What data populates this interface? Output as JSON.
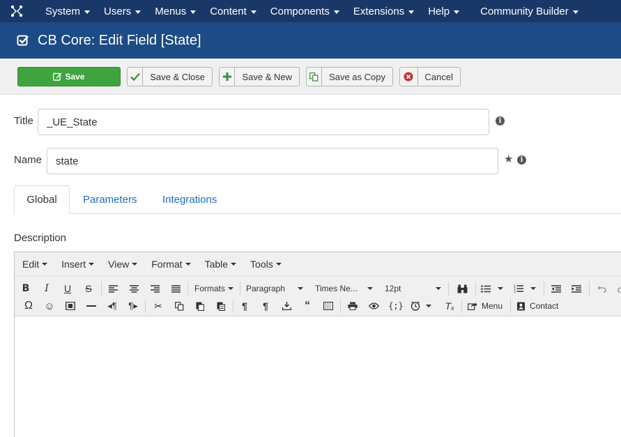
{
  "nav": {
    "items": [
      {
        "label": "System",
        "name": "nav-system"
      },
      {
        "label": "Users",
        "name": "nav-users"
      },
      {
        "label": "Menus",
        "name": "nav-menus"
      },
      {
        "label": "Content",
        "name": "nav-content"
      },
      {
        "label": "Components",
        "name": "nav-components"
      },
      {
        "label": "Extensions",
        "name": "nav-extensions"
      },
      {
        "label": "Help",
        "name": "nav-help"
      }
    ],
    "cb_label": "Community Builder"
  },
  "header": {
    "title": "CB Core: Edit Field [State]"
  },
  "toolbar": {
    "save_label": "Save",
    "save_close_label": "Save & Close",
    "save_new_label": "Save & New",
    "save_copy_label": "Save as Copy",
    "cancel_label": "Cancel"
  },
  "form": {
    "title_label": "Title",
    "title_value": "_UE_State",
    "name_label": "Name",
    "name_value": "state"
  },
  "tabs": {
    "global": "Global",
    "parameters": "Parameters",
    "integrations": "Integrations"
  },
  "editor": {
    "description_label": "Description",
    "menu": {
      "edit": "Edit",
      "insert": "Insert",
      "view": "View",
      "format": "Format",
      "table": "Table",
      "tools": "Tools"
    },
    "formats_label": "Formats",
    "paragraph_label": "Paragraph",
    "font_label": "Times Ne...",
    "size_label": "12pt",
    "menu_button_label": "Menu",
    "contact_button_label": "Contact"
  },
  "colors": {
    "nav_bg": "#1a3867",
    "title_bg": "#1d4b85",
    "save_green": "#3fa43d",
    "link_blue": "#1b6ec2",
    "cancel_red": "#bd362f"
  }
}
